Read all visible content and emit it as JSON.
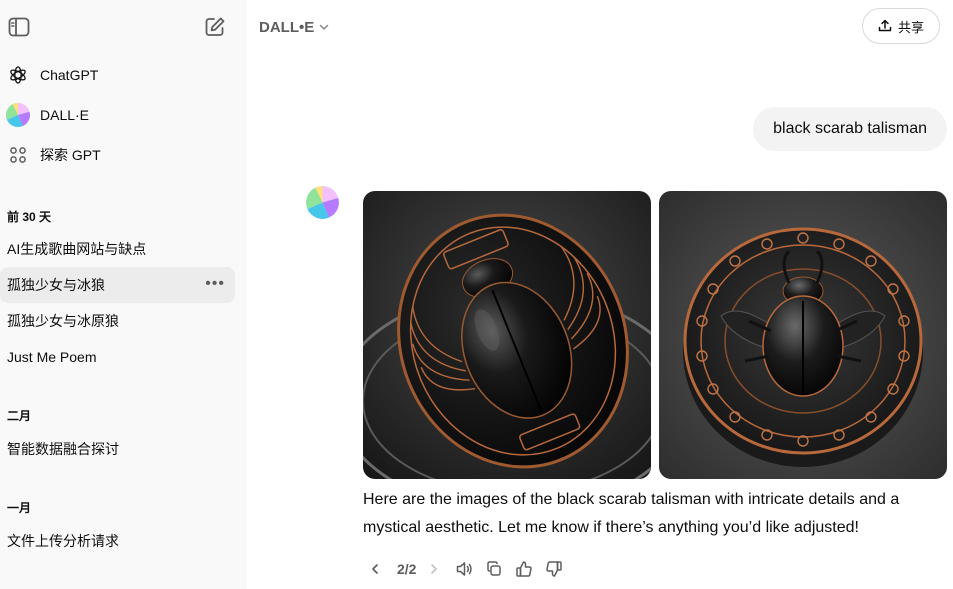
{
  "sidebar": {
    "nav": [
      {
        "label": "ChatGPT",
        "icon": "openai-logo-icon"
      },
      {
        "label": "DALL·E",
        "icon": "dalle-avatar-icon"
      },
      {
        "label": "探索 GPT",
        "icon": "grid-dots-icon"
      }
    ],
    "sections": [
      {
        "title": "前 30 天",
        "items": [
          "AI生成歌曲网站与缺点",
          "孤独少女与冰狼",
          "孤独少女与冰原狼",
          "Just Me Poem"
        ]
      },
      {
        "title": "二月",
        "items": [
          "智能数据融合探讨"
        ]
      },
      {
        "title": "一月",
        "items": [
          "文件上传分析请求"
        ]
      }
    ],
    "active_item": "孤独少女与冰狼"
  },
  "header": {
    "model_name": "DALL•E",
    "share_label": "共享"
  },
  "conversation": {
    "user_message": "black scarab talisman",
    "assistant_text": "Here are the images of the black scarab talisman with intricate details and a mystical aesthetic. Let me know if there’s anything you’d like adjusted!",
    "pager": "2/2"
  },
  "colors": {
    "sidebar_bg": "#f9f9f9",
    "active_bg": "#ececec",
    "bubble_bg": "#f3f3f3",
    "copper": "#b8693c"
  }
}
